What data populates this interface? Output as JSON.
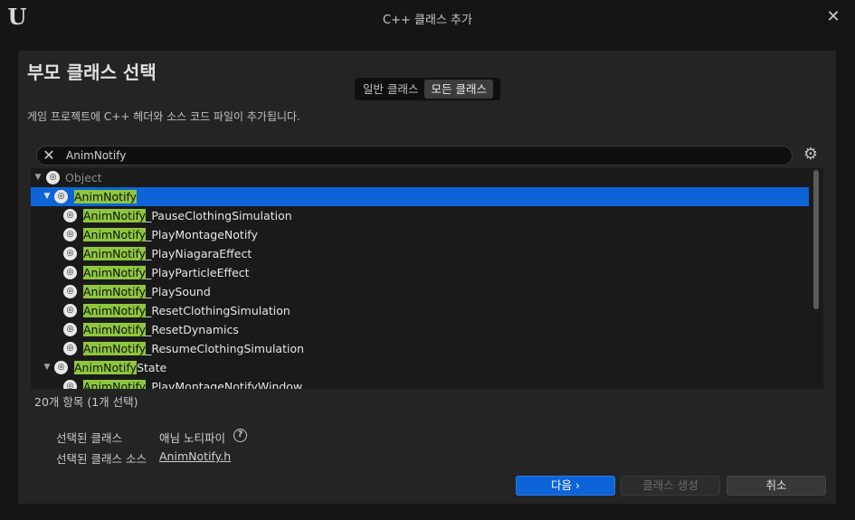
{
  "window": {
    "title": "C++ 클래스 추가"
  },
  "heading": "부모 클래스 선택",
  "toggle": {
    "common": "일반 클래스",
    "all": "모든 클래스"
  },
  "description": "게임 프로젝트에 C++ 헤더와 소스 코드 파일이 추가됩니다.",
  "search": {
    "value": "AnimNotify"
  },
  "tree": {
    "root": "Object",
    "nodes": [
      {
        "hl": "AnimNotify",
        "rest": ""
      },
      {
        "hl": "AnimNotify",
        "rest": "_PauseClothingSimulation"
      },
      {
        "hl": "AnimNotify",
        "rest": "_PlayMontageNotify"
      },
      {
        "hl": "AnimNotify",
        "rest": "_PlayNiagaraEffect"
      },
      {
        "hl": "AnimNotify",
        "rest": "_PlayParticleEffect"
      },
      {
        "hl": "AnimNotify",
        "rest": "_PlaySound"
      },
      {
        "hl": "AnimNotify",
        "rest": "_ResetClothingSimulation"
      },
      {
        "hl": "AnimNotify",
        "rest": "_ResetDynamics"
      },
      {
        "hl": "AnimNotify",
        "rest": "_ResumeClothingSimulation"
      },
      {
        "hl": "AnimNotify",
        "rest": "State"
      },
      {
        "hl": "AnimNotify",
        "rest": "_PlayMontageNotifyWindow"
      }
    ]
  },
  "status": {
    "count": "20개 항목 (1개 선택)"
  },
  "info": {
    "selected_class_label": "선택된 클래스",
    "selected_class_value": "애님 노티파이",
    "selected_source_label": "선택된 클래스 소스",
    "selected_source_value": "AnimNotify.h"
  },
  "buttons": {
    "next": "다음 ›",
    "create": "클래스 생성",
    "cancel": "취소"
  },
  "colors": {
    "accent": "#0c64d8",
    "highlight": "#8ec63f"
  }
}
